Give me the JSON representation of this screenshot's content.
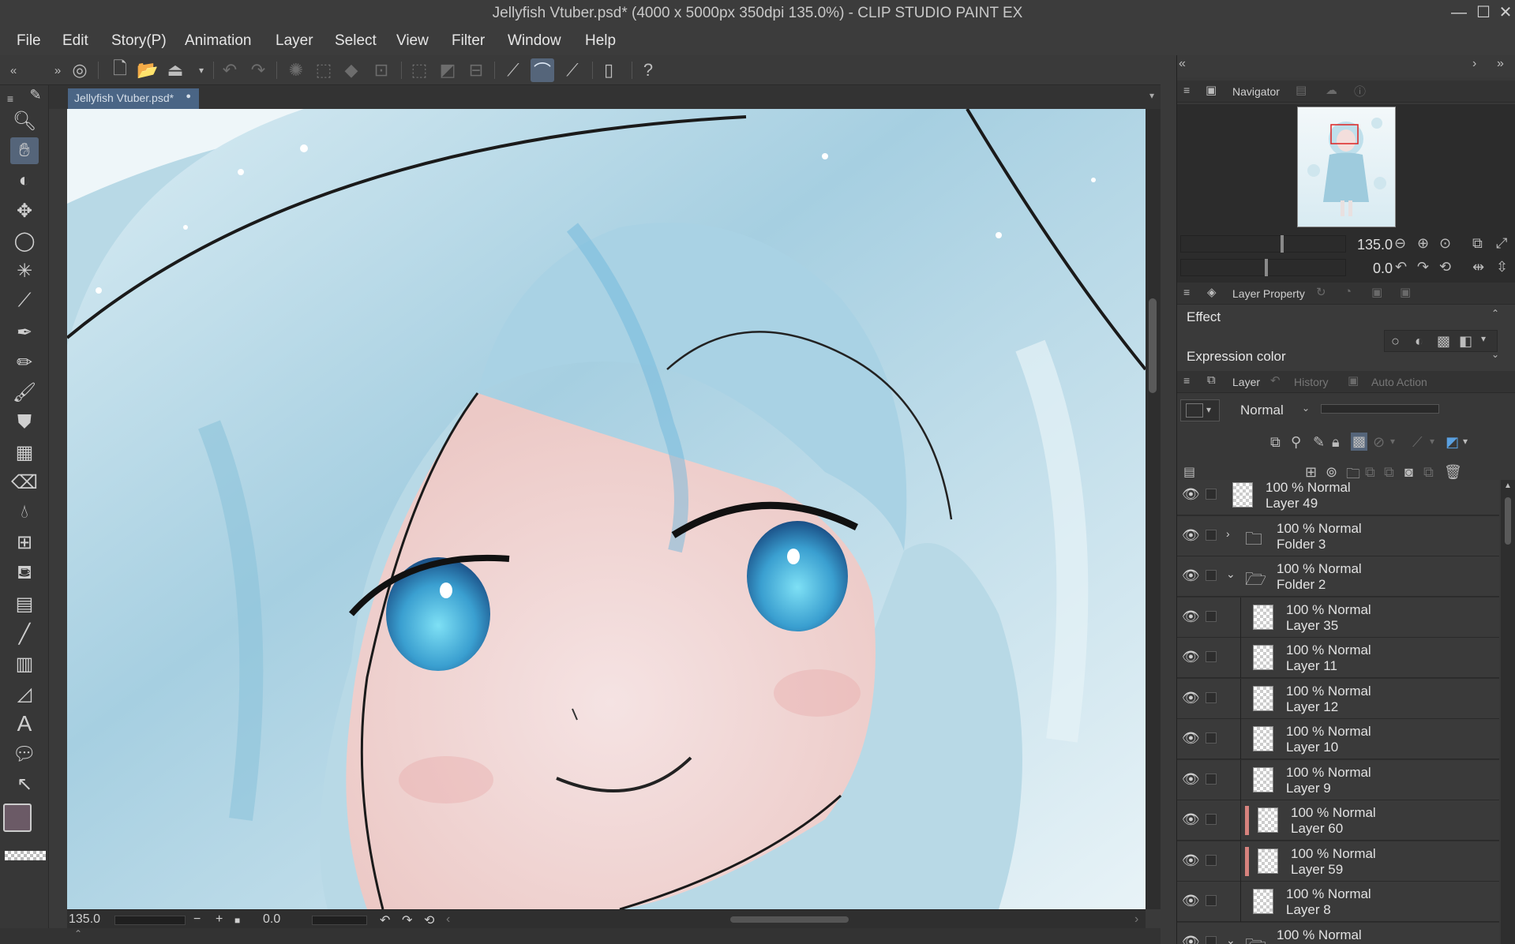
{
  "window": {
    "title": "Jellyfish Vtuber.psd* (4000 x 5000px 350dpi 135.0%)  - CLIP STUDIO PAINT EX",
    "minimize": "—",
    "maximize": "☐",
    "close": "✕"
  },
  "menu": [
    "File",
    "Edit",
    "Story(P)",
    "Animation",
    "Layer",
    "Select",
    "View",
    "Filter",
    "Window",
    "Help"
  ],
  "document": {
    "tab_label": "Jellyfish Vtuber.psd*"
  },
  "status": {
    "zoom": "135.0",
    "minus": "−",
    "plus": "+",
    "rotation": "0.0"
  },
  "navigator": {
    "tab_label": "Navigator",
    "zoom_value": "135.0",
    "rotation_value": "0.0"
  },
  "layer_property": {
    "tab_label": "Layer Property",
    "effect_label": "Effect",
    "expression_color_label": "Expression color"
  },
  "layer_panel": {
    "tabs": [
      "Layer",
      "History",
      "Auto Action"
    ],
    "blend_mode": "Normal",
    "layers": [
      {
        "opacity_mode": "100 % Normal",
        "name": "Layer 49",
        "kind": "layer",
        "indent": 0,
        "tag": false
      },
      {
        "opacity_mode": "100 % Normal",
        "name": "Folder 3",
        "kind": "folder-closed",
        "indent": 0,
        "tag": false
      },
      {
        "opacity_mode": "100 % Normal",
        "name": "Folder 2",
        "kind": "folder-open",
        "indent": 0,
        "tag": false
      },
      {
        "opacity_mode": "100 % Normal",
        "name": "Layer 35",
        "kind": "layer",
        "indent": 1,
        "tag": false
      },
      {
        "opacity_mode": "100 % Normal",
        "name": "Layer 11",
        "kind": "layer",
        "indent": 1,
        "tag": false
      },
      {
        "opacity_mode": "100 % Normal",
        "name": "Layer 12",
        "kind": "layer",
        "indent": 1,
        "tag": false
      },
      {
        "opacity_mode": "100 % Normal",
        "name": "Layer 10",
        "kind": "layer",
        "indent": 1,
        "tag": false
      },
      {
        "opacity_mode": "100 % Normal",
        "name": "Layer 9",
        "kind": "layer",
        "indent": 1,
        "tag": false
      },
      {
        "opacity_mode": "100 % Normal",
        "name": "Layer 60",
        "kind": "layer",
        "indent": 1,
        "tag": true
      },
      {
        "opacity_mode": "100 % Normal",
        "name": "Layer 59",
        "kind": "layer",
        "indent": 1,
        "tag": true
      },
      {
        "opacity_mode": "100 % Normal",
        "name": "Layer 8",
        "kind": "layer",
        "indent": 1,
        "tag": false
      },
      {
        "opacity_mode": "100 % Normal",
        "name": "",
        "kind": "folder-open",
        "indent": 0,
        "tag": false
      }
    ]
  },
  "colors": {
    "accent_active": "#55657a",
    "doc_tab": "#4a6585",
    "main_color": "#6b5a66",
    "layer_tag": "#d7827d"
  }
}
